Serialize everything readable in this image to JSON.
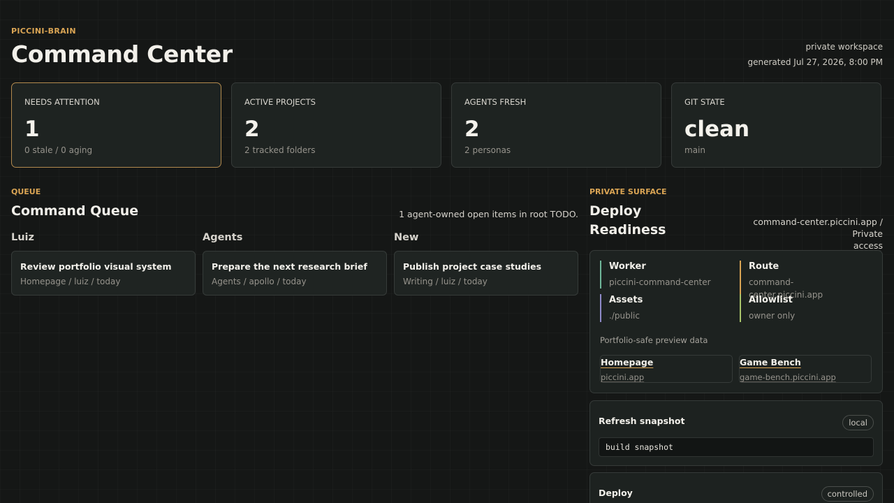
{
  "header": {
    "eyebrow": "PICCINI-BRAIN",
    "title": "Command Center",
    "workspace": "private workspace",
    "generated": "generated Jul 27, 2026, 8:00 PM"
  },
  "stats": [
    {
      "label": "NEEDS ATTENTION",
      "value": "1",
      "sub": "0 stale / 0 aging"
    },
    {
      "label": "ACTIVE PROJECTS",
      "value": "2",
      "sub": "2 tracked folders"
    },
    {
      "label": "AGENTS FRESH",
      "value": "2",
      "sub": "2 personas"
    },
    {
      "label": "GIT STATE",
      "value": "clean",
      "sub": "main"
    }
  ],
  "queue": {
    "eyebrow": "QUEUE",
    "title": "Command Queue",
    "meta": "1 agent-owned open items in root TODO.",
    "columns": [
      {
        "heading": "Luiz",
        "card": {
          "title": "Review portfolio visual system",
          "sub": "Homepage / luiz / today"
        }
      },
      {
        "heading": "Agents",
        "card": {
          "title": "Prepare the next research brief",
          "sub": "Agents / apollo / today"
        }
      },
      {
        "heading": "New",
        "card": {
          "title": "Publish project case studies",
          "sub": "Writing / luiz / today"
        }
      }
    ]
  },
  "deploy": {
    "eyebrow": "PRIVATE SURFACE",
    "title_line1": "Deploy",
    "title_line2": "Readiness",
    "domain_line1": "command-center.piccini.app / Private",
    "domain_line2": "access",
    "kv": [
      {
        "key": "Worker",
        "value": "piccini-command-center",
        "color": "#6fb79a"
      },
      {
        "key": "Route",
        "value": "command-center.piccini.app",
        "color": "#d9a454"
      },
      {
        "key": "Assets",
        "value": "./public",
        "color": "#8f8ac9"
      },
      {
        "key": "Allowlist",
        "value": "owner only",
        "color": "#a9c46a"
      }
    ],
    "preview_label": "Portfolio-safe preview data",
    "links": [
      {
        "title": "Homepage",
        "url": "piccini.app"
      },
      {
        "title": "Game Bench",
        "url": "game-bench.piccini.app"
      }
    ],
    "tasks": [
      {
        "title": "Refresh snapshot",
        "badge": "local",
        "command": "build snapshot"
      },
      {
        "title": "Deploy",
        "badge": "controlled"
      }
    ]
  }
}
